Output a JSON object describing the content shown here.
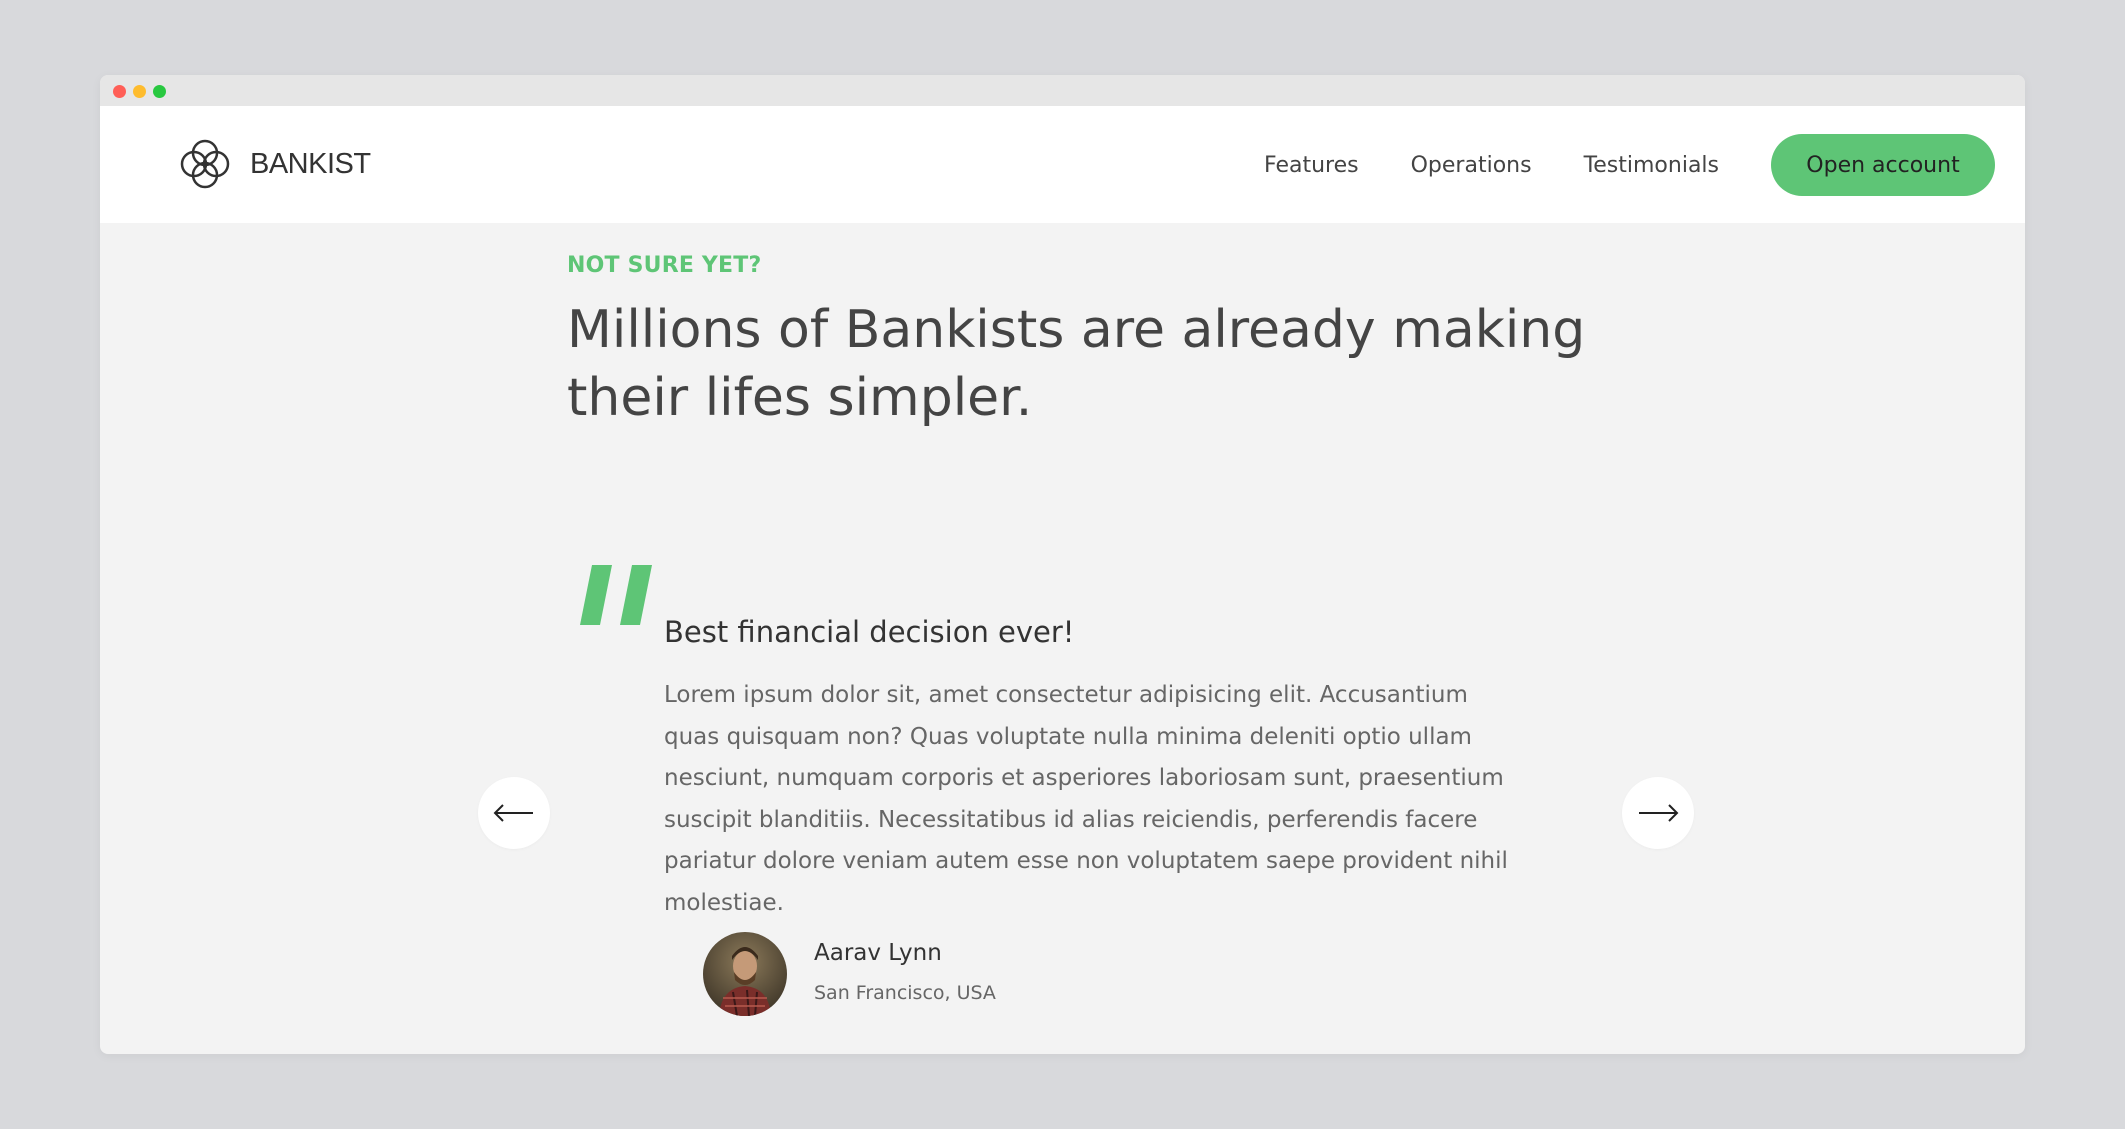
{
  "window": {
    "controls": [
      "close",
      "minimize",
      "maximize"
    ]
  },
  "nav": {
    "brand": "BANKIST",
    "links": [
      "Features",
      "Operations",
      "Testimonials"
    ],
    "cta": "Open account"
  },
  "section": {
    "eyebrow": "NOT SURE YET?",
    "heading": "Millions of Bankists are already making their lifes simpler."
  },
  "testimonial": {
    "title": "Best financial decision ever!",
    "text": "Lorem ipsum dolor sit, amet consectetur adipisicing elit. Accusantium quas quisquam non? Quas voluptate nulla minima deleniti optio ullam nesciunt, numquam corporis et asperiores laboriosam sunt, praesentium suscipit blanditiis. Necessitatibus id alias reiciendis, perferendis facere pariatur dolore veniam autem esse non voluptatem saepe provident nihil molestiae.",
    "author": {
      "name": "Aarav Lynn",
      "location": "San Francisco, USA"
    }
  },
  "icons": {
    "logo": "bankist-logo-icon",
    "quote": "quote-mark-icon",
    "prev": "arrow-left-icon",
    "next": "arrow-right-icon"
  },
  "colors": {
    "accent": "#5ec576",
    "text": "#444444",
    "background": "#f3f3f3",
    "navbar": "#ffffff"
  }
}
